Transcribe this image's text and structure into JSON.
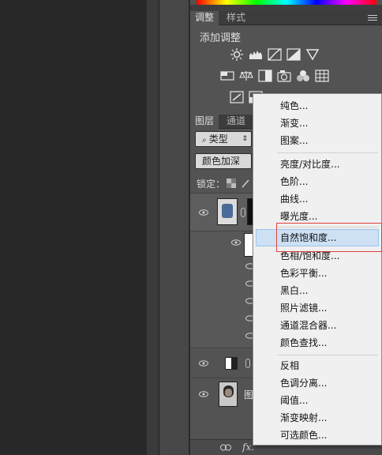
{
  "adjustments_panel": {
    "tabs": [
      "调整",
      "样式"
    ],
    "title": "添加调整"
  },
  "layers_panel": {
    "tabs": [
      "图层",
      "通道"
    ],
    "filter_kind": "类型",
    "blend_mode": "颜色加深",
    "lock_label": "锁定：",
    "bottom_fx": "fx.",
    "partial_layer_name": "图"
  },
  "menu": {
    "groups": [
      [
        "纯色...",
        "渐变...",
        "图案..."
      ],
      [
        "亮度/对比度...",
        "色阶...",
        "曲线...",
        "曝光度..."
      ],
      [
        "自然饱和度...",
        "色相/饱和度...",
        "色彩平衡...",
        "黑白...",
        "照片滤镜...",
        "通道混合器...",
        "颜色查找..."
      ],
      [
        "反相",
        "色调分离...",
        "阈值...",
        "渐变映射...",
        "可选颜色..."
      ]
    ],
    "highlighted": "自然饱和度..."
  },
  "colors": {
    "highlight": "#cde0f4",
    "annotation_frame": "#e0403a"
  }
}
